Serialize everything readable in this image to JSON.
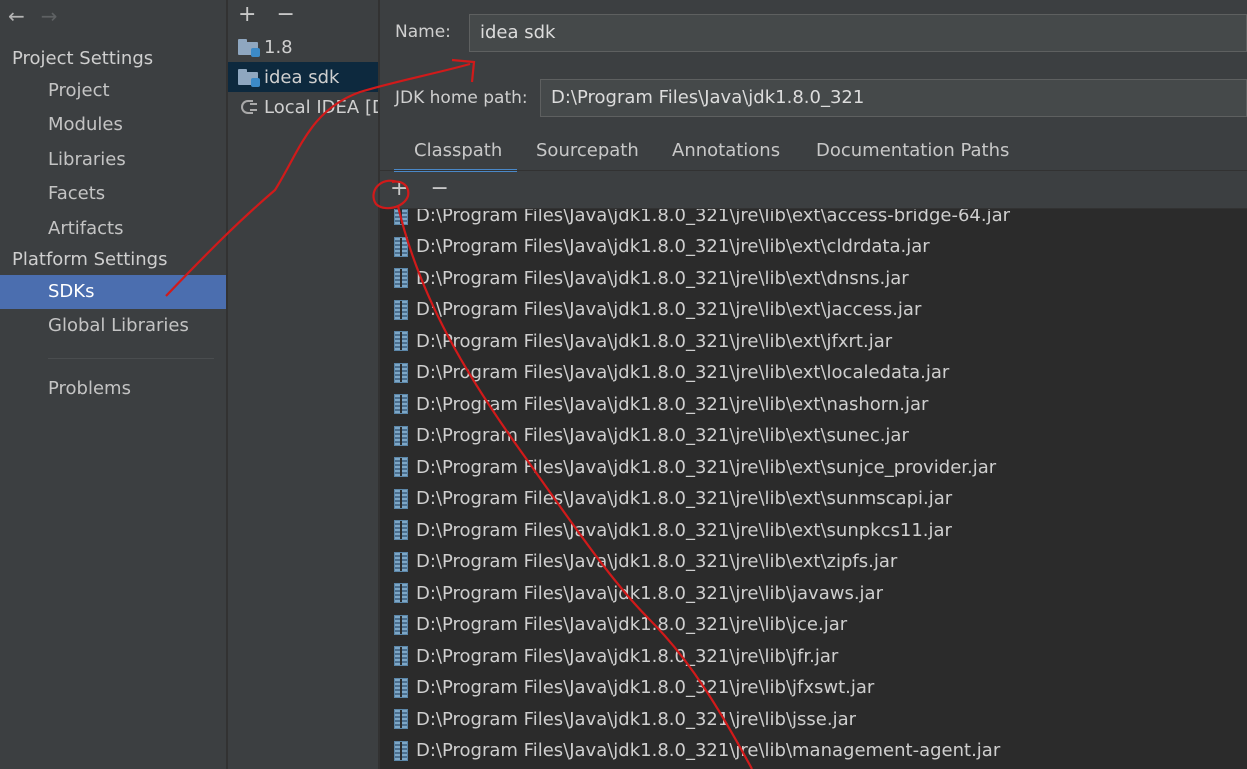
{
  "nav": {
    "back_glyph": "←",
    "forward_glyph": "→",
    "project_settings": "Project Settings",
    "items_project": [
      "Project",
      "Modules",
      "Libraries",
      "Facets",
      "Artifacts"
    ],
    "platform_settings": "Platform Settings",
    "items_platform": [
      "SDKs",
      "Global Libraries"
    ],
    "problems": "Problems",
    "selected": "SDKs"
  },
  "sdk_list": {
    "add_glyph": "+",
    "remove_glyph": "−",
    "items": [
      {
        "label": "1.8",
        "icon": "folder-icon"
      },
      {
        "label": "idea sdk",
        "icon": "folder-icon"
      },
      {
        "label": "Local IDEA [D",
        "icon": "plug-icon"
      }
    ],
    "selected": "idea sdk"
  },
  "detail": {
    "name_label": "Name:",
    "name_value": "idea sdk",
    "jdk_label": "JDK home path:",
    "jdk_value": "D:\\Program Files\\Java\\jdk1.8.0_321",
    "tabs": [
      "Classpath",
      "Sourcepath",
      "Annotations",
      "Documentation Paths"
    ],
    "active_tab": "Classpath",
    "add_glyph": "+",
    "remove_glyph": "−",
    "classpath": [
      "D:\\Program Files\\Java\\jdk1.8.0_321\\jre\\lib\\ext\\access-bridge-64.jar",
      "D:\\Program Files\\Java\\jdk1.8.0_321\\jre\\lib\\ext\\cldrdata.jar",
      "D:\\Program Files\\Java\\jdk1.8.0_321\\jre\\lib\\ext\\dnsns.jar",
      "D:\\Program Files\\Java\\jdk1.8.0_321\\jre\\lib\\ext\\jaccess.jar",
      "D:\\Program Files\\Java\\jdk1.8.0_321\\jre\\lib\\ext\\jfxrt.jar",
      "D:\\Program Files\\Java\\jdk1.8.0_321\\jre\\lib\\ext\\localedata.jar",
      "D:\\Program Files\\Java\\jdk1.8.0_321\\jre\\lib\\ext\\nashorn.jar",
      "D:\\Program Files\\Java\\jdk1.8.0_321\\jre\\lib\\ext\\sunec.jar",
      "D:\\Program Files\\Java\\jdk1.8.0_321\\jre\\lib\\ext\\sunjce_provider.jar",
      "D:\\Program Files\\Java\\jdk1.8.0_321\\jre\\lib\\ext\\sunmscapi.jar",
      "D:\\Program Files\\Java\\jdk1.8.0_321\\jre\\lib\\ext\\sunpkcs11.jar",
      "D:\\Program Files\\Java\\jdk1.8.0_321\\jre\\lib\\ext\\zipfs.jar",
      "D:\\Program Files\\Java\\jdk1.8.0_321\\jre\\lib\\javaws.jar",
      "D:\\Program Files\\Java\\jdk1.8.0_321\\jre\\lib\\jce.jar",
      "D:\\Program Files\\Java\\jdk1.8.0_321\\jre\\lib\\jfr.jar",
      "D:\\Program Files\\Java\\jdk1.8.0_321\\jre\\lib\\jfxswt.jar",
      "D:\\Program Files\\Java\\jdk1.8.0_321\\jre\\lib\\jsse.jar",
      "D:\\Program Files\\Java\\jdk1.8.0_321\\jre\\lib\\management-agent.jar"
    ]
  },
  "colors": {
    "background": "#3c3f41",
    "selection": "#4b6eaf",
    "list_selection": "#0d293e",
    "tab_underline": "#4a88c7",
    "annotation": "#d11a1a"
  }
}
